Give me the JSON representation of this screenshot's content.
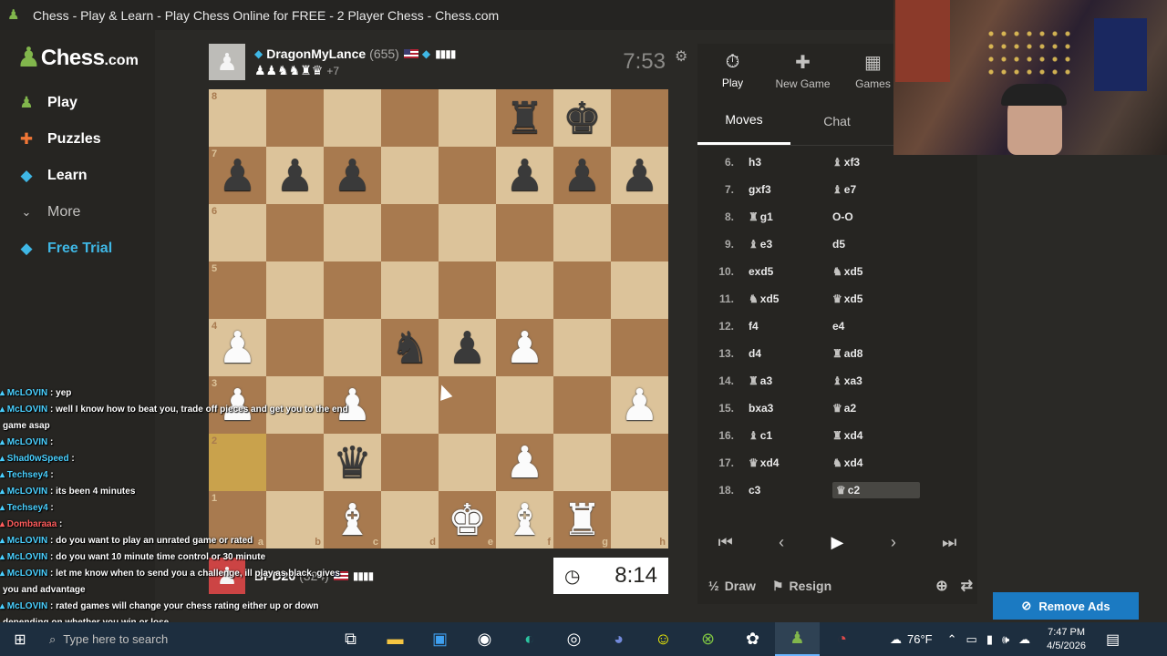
{
  "window": {
    "title": "Chess - Play & Learn - Play Chess Online for FREE - 2 Player Chess - Chess.com"
  },
  "sidebar": {
    "brand": "Chess",
    "brand_suffix": ".com",
    "items": [
      {
        "label": "Play",
        "icon": "play-pawn-icon"
      },
      {
        "label": "Puzzles",
        "icon": "puzzle-icon"
      },
      {
        "label": "Learn",
        "icon": "learn-icon"
      },
      {
        "label": "More",
        "icon": "chevron-down-icon"
      },
      {
        "label": "Free Trial",
        "icon": "diamond-icon"
      }
    ]
  },
  "top_player": {
    "name": "DragonMyLance",
    "rating": "(655)",
    "captured": "♟♟♞♞♜♛",
    "advantage": "+7",
    "clock": "7:53"
  },
  "bottom_player": {
    "name": "BPD26",
    "rating": "(324)",
    "clock": "8:14"
  },
  "board": {
    "ranks": [
      "8",
      "7",
      "6",
      "5",
      "4",
      "3",
      "2",
      "1"
    ],
    "files": [
      "a",
      "b",
      "c",
      "d",
      "e",
      "f",
      "g",
      "h"
    ],
    "pieces": [
      [
        "",
        "",
        "",
        "",
        "",
        "br",
        "bk",
        ""
      ],
      [
        "bp",
        "bp",
        "bp",
        "",
        "",
        "bp",
        "bp",
        "bp"
      ],
      [
        "",
        "",
        "",
        "",
        "",
        "",
        "",
        ""
      ],
      [
        "",
        "",
        "",
        "",
        "",
        "",
        "",
        ""
      ],
      [
        "wp",
        "",
        "",
        "bn",
        "bp",
        "wp",
        "",
        ""
      ],
      [
        "wp",
        "",
        "wp",
        "",
        "",
        "",
        "",
        "wp"
      ],
      [
        "",
        "",
        "bq",
        "",
        "",
        "wp",
        "",
        ""
      ],
      [
        "",
        "",
        "wb",
        "",
        "wk",
        "wb",
        "wr",
        ""
      ]
    ],
    "highlight": [
      6,
      0
    ]
  },
  "panel": {
    "tabs": [
      {
        "label": "Play",
        "icon": "stopwatch-icon"
      },
      {
        "label": "New Game",
        "icon": "plus-icon"
      },
      {
        "label": "Games",
        "icon": "board-icon"
      }
    ],
    "subtabs": [
      "Moves",
      "Chat"
    ],
    "moves": [
      {
        "no": "6.",
        "w": "h3",
        "wi": "",
        "b": "xf3",
        "bi": "♝"
      },
      {
        "no": "7.",
        "w": "gxf3",
        "wi": "",
        "b": "e7",
        "bi": "♝"
      },
      {
        "no": "8.",
        "w": "g1",
        "wi": "♜",
        "b": "O-O",
        "bi": ""
      },
      {
        "no": "9.",
        "w": "e3",
        "wi": "♝",
        "b": "d5",
        "bi": ""
      },
      {
        "no": "10.",
        "w": "exd5",
        "wi": "",
        "b": "xd5",
        "bi": "♞"
      },
      {
        "no": "11.",
        "w": "xd5",
        "wi": "♞",
        "b": "xd5",
        "bi": "♛"
      },
      {
        "no": "12.",
        "w": "f4",
        "wi": "",
        "b": "e4",
        "bi": ""
      },
      {
        "no": "13.",
        "w": "d4",
        "wi": "",
        "b": "ad8",
        "bi": "♜"
      },
      {
        "no": "14.",
        "w": "a3",
        "wi": "♜",
        "b": "xa3",
        "bi": "♝"
      },
      {
        "no": "15.",
        "w": "bxa3",
        "wi": "",
        "b": "a2",
        "bi": "♛"
      },
      {
        "no": "16.",
        "w": "c1",
        "wi": "♝",
        "b": "xd4",
        "bi": "♜"
      },
      {
        "no": "17.",
        "w": "xd4",
        "wi": "♛",
        "b": "xd4",
        "bi": "♞"
      },
      {
        "no": "18.",
        "w": "c3",
        "wi": "",
        "b": "c2",
        "bi": "♛"
      }
    ],
    "actions": {
      "draw": "Draw",
      "draw_icon": "½",
      "resign": "Resign"
    }
  },
  "remove_ads": "Remove Ads",
  "chat": [
    {
      "user": "McLOVIN",
      "msg": ": yep"
    },
    {
      "user": "McLOVIN",
      "msg": ": well I know how to beat you, trade off pieces and get you to the end"
    },
    {
      "user": "",
      "msg": "game asap"
    },
    {
      "user": "McLOVIN",
      "msg": ":"
    },
    {
      "user": "Shad0wSpeed",
      "msg": ":"
    },
    {
      "user": "Techsey4",
      "msg": ":"
    },
    {
      "user": "McLOVIN",
      "msg": ": its been 4 minutes"
    },
    {
      "user": "Techsey4",
      "msg": ":"
    },
    {
      "user": "Dombaraaa",
      "msg": ":"
    },
    {
      "user": "McLOVIN",
      "msg": ": do you want to play an unrated game or rated"
    },
    {
      "user": "McLOVIN",
      "msg": ": do you want 10 minute time control or 30 minute"
    },
    {
      "user": "McLOVIN",
      "msg": ": let me know when to send you a challenge, ill play as black, gives"
    },
    {
      "user": "",
      "msg": "you and advantage"
    },
    {
      "user": "McLOVIN",
      "msg": ": rated games will change your chess rating either up or down"
    },
    {
      "user": "",
      "msg": "depending on whether you win or lose"
    },
    {
      "user": "McLOVIN",
      "msg": ": unrated games will not change your chess rating"
    }
  ],
  "taskbar": {
    "search_placeholder": "Type here to search",
    "temperature": "76°F",
    "time": "7:47 PM",
    "date": "4/5/2026"
  }
}
